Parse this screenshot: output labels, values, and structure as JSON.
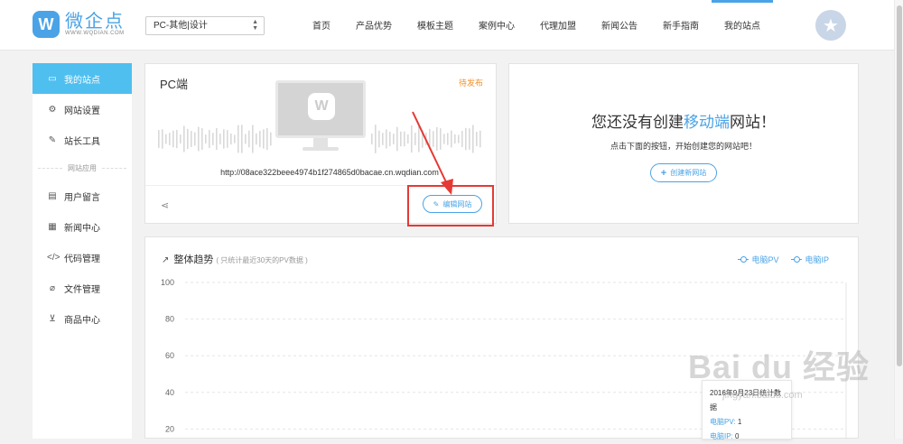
{
  "brand": {
    "name": "微企点",
    "url": "WWW.WQDIAN.COM",
    "mark": "W",
    "color": "#4aa3e6"
  },
  "site_select": {
    "value": "PC-其他|设计"
  },
  "nav": [
    {
      "label": "首页"
    },
    {
      "label": "产品优势"
    },
    {
      "label": "模板主题"
    },
    {
      "label": "案例中心"
    },
    {
      "label": "代理加盟"
    },
    {
      "label": "新闻公告"
    },
    {
      "label": "新手指南"
    },
    {
      "label": "我的站点",
      "active": true
    }
  ],
  "sidebar": {
    "items": [
      {
        "label": "我的站点",
        "icon": "monitor-icon",
        "active": true
      },
      {
        "label": "网站设置",
        "icon": "gear-icon"
      },
      {
        "label": "站长工具",
        "icon": "wrench-icon"
      }
    ],
    "section": "网站应用",
    "apps": [
      {
        "label": "用户留言",
        "icon": "message-icon"
      },
      {
        "label": "新闻中心",
        "icon": "document-icon"
      },
      {
        "label": "代码管理",
        "icon": "code-icon"
      },
      {
        "label": "文件管理",
        "icon": "paperclip-icon"
      },
      {
        "label": "商品中心",
        "icon": "cart-icon"
      }
    ]
  },
  "pc_card": {
    "title": "PC端",
    "status": "待发布",
    "url": "http://08ace322beee4974b1f274865d0bacae.cn.wqdian.com",
    "edit_label": "编辑网站"
  },
  "mobile_card": {
    "title_pre": "您还没有创建",
    "title_highlight": "移动端",
    "title_post": "网站！",
    "subtitle": "点击下面的按钮，开始创建您的网站吧！",
    "create_label": "创建新网站"
  },
  "trend": {
    "title": "整体趋势",
    "note": "( 只统计最近30天的PV数据 )",
    "legend": [
      "电脑PV",
      "电脑IP"
    ]
  },
  "tooltip": {
    "date": "2016年9月23日统计数据",
    "pv_label": "电脑PV:",
    "pv_value": "1",
    "ip_label": "电脑IP:",
    "ip_value": "0"
  },
  "watermark": {
    "text": "Bai du 经验",
    "url": "jingyan.baidu.com"
  },
  "chart_data": {
    "type": "line",
    "title": "整体趋势",
    "ylim": [
      0,
      100
    ],
    "yticks": [
      100,
      80,
      60,
      40,
      20
    ],
    "grid": true,
    "legend_position": "top-right",
    "series": [
      {
        "name": "电脑PV",
        "values": []
      },
      {
        "name": "电脑IP",
        "values": []
      }
    ]
  }
}
